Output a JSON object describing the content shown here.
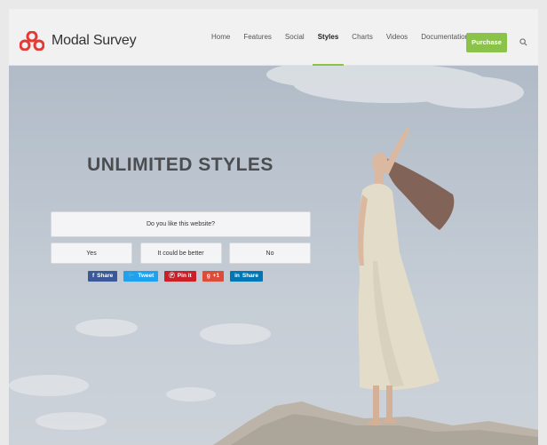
{
  "header": {
    "brand": "Modal Survey",
    "nav": [
      "Home",
      "Features",
      "Social",
      "Styles",
      "Charts",
      "Videos",
      "Documentation"
    ],
    "active_nav": "Styles",
    "purchase_label": "Purchase",
    "accent_color": "#8bc34a"
  },
  "hero": {
    "headline": "UNLIMITED STYLES",
    "survey": {
      "question": "Do you like this website?",
      "answers": [
        "Yes",
        "It could be better",
        "No"
      ]
    },
    "share_buttons": [
      {
        "label": "Share",
        "icon": "facebook-icon",
        "color": "#3b5998"
      },
      {
        "label": "Tweet",
        "icon": "twitter-icon",
        "color": "#1da1f2"
      },
      {
        "label": "Pin it",
        "icon": "pinterest-icon",
        "color": "#cb2027"
      },
      {
        "label": "+1",
        "icon": "google-plus-icon",
        "color": "#dd4b39"
      },
      {
        "label": "Share",
        "icon": "linkedin-icon",
        "color": "#0077b5"
      }
    ]
  }
}
